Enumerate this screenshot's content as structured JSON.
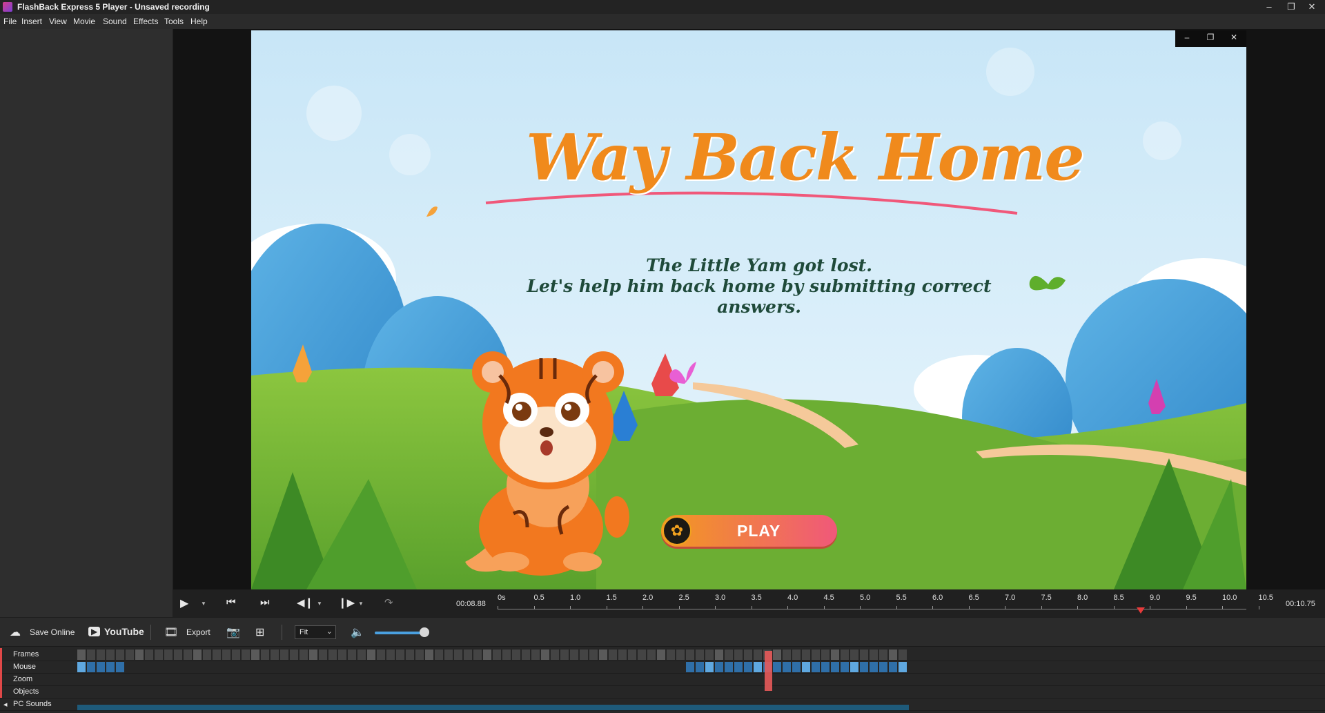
{
  "window": {
    "title": "FlashBack Express 5 Player - Unsaved recording"
  },
  "menu": [
    "File",
    "Insert",
    "View",
    "Movie",
    "Sound",
    "Effects",
    "Tools",
    "Help"
  ],
  "video": {
    "title": "Way Back Home",
    "subtitle_line1": "The Little Yam got lost.",
    "subtitle_line2": "Let's help him back home by submitting correct answers.",
    "play_label": "PLAY"
  },
  "transport": {
    "current_time": "00:08.88",
    "total_time": "00:10.75",
    "ticks": [
      "0s",
      "0.5",
      "1.0",
      "1.5",
      "2.0",
      "2.5",
      "3.0",
      "3.5",
      "4.0",
      "4.5",
      "5.0",
      "5.5",
      "6.0",
      "6.5",
      "7.0",
      "7.5",
      "8.0",
      "8.5",
      "9.0",
      "9.5",
      "10.0",
      "10.5"
    ],
    "playhead_seconds": 8.88,
    "duration_seconds": 10.75
  },
  "toolbar": {
    "save_online": "Save Online",
    "youtube": "YouTube",
    "export": "Export",
    "zoom_fit": "Fit",
    "volume_level": 0.9
  },
  "timeline": {
    "rows": [
      "Frames",
      "Mouse",
      "Zoom",
      "Objects",
      "PC Sounds"
    ]
  },
  "colors": {
    "accent": "#4aa0e0",
    "playhead": "#e83b3b",
    "title_orange": "#f08a1c",
    "title_pink": "#e8457a"
  }
}
